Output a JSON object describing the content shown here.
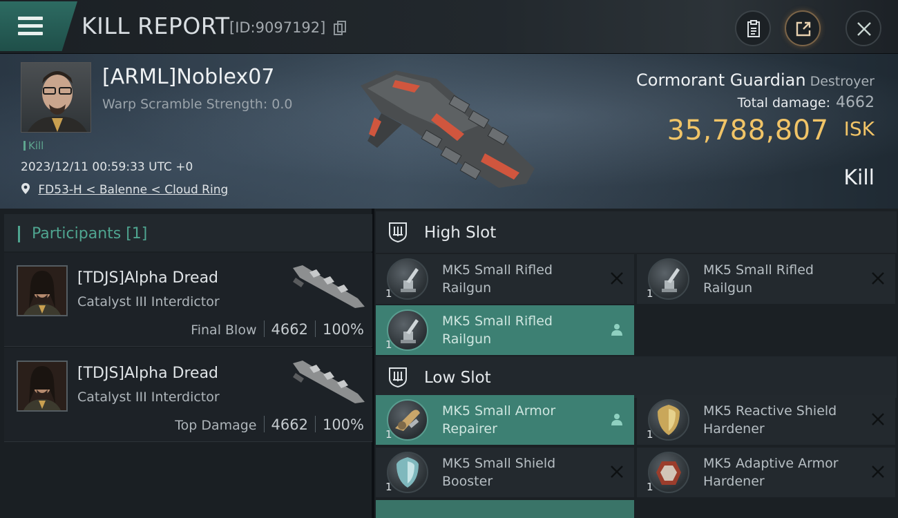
{
  "header": {
    "title": "KILL REPORT",
    "report_id": "[ID:9097192]"
  },
  "victim": {
    "pilot_name": "[ARML]Noblex07",
    "warp_scramble": "Warp Scramble Strength: 0.0",
    "kill_tag": "Kill",
    "timestamp": "2023/12/11 00:59:33 UTC +0",
    "location": "FD53-H < Balenne < Cloud Ring",
    "ship_name": "Cormorant Guardian",
    "ship_class": "Destroyer",
    "total_damage_label": "Total damage:",
    "total_damage": "4662",
    "isk_value": "35,788,807",
    "isk_unit": "ISK",
    "result": "Kill"
  },
  "participants": {
    "title": "Participants [1]",
    "rows": [
      {
        "name": "[TDJS]Alpha Dread",
        "ship": "Catalyst III Interdictor",
        "role": "Final Blow",
        "damage": "4662",
        "percent": "100%"
      },
      {
        "name": "[TDJS]Alpha Dread",
        "ship": "Catalyst III Interdictor",
        "role": "Top Damage",
        "damage": "4662",
        "percent": "100%"
      }
    ]
  },
  "fitting": {
    "high_slot_label": "High Slot",
    "low_slot_label": "Low Slot",
    "high": [
      {
        "name": "MK5 Small Rifled Railgun",
        "qty": "1",
        "state": "destroyed"
      },
      {
        "name": "MK5 Small Rifled Railgun",
        "qty": "1",
        "state": "destroyed"
      },
      {
        "name": "MK5 Small Rifled Railgun",
        "qty": "1",
        "state": "dropped"
      }
    ],
    "low": [
      {
        "name": "MK5 Small Armor Repairer",
        "qty": "1",
        "state": "dropped"
      },
      {
        "name": "MK5 Reactive Shield Hardener",
        "qty": "1",
        "state": "destroyed"
      },
      {
        "name": "MK5 Small Shield Booster",
        "qty": "1",
        "state": "destroyed"
      },
      {
        "name": "MK5 Adaptive Armor Hardener",
        "qty": "1",
        "state": "destroyed"
      }
    ]
  },
  "colors": {
    "accent": "#3d8073",
    "isk": "#f1c467",
    "participants_header": "#4fa590"
  },
  "icons": {
    "menu": "hamburger-icon",
    "copy": "copy-icon",
    "clipboard": "clipboard-icon",
    "share": "share-icon",
    "close": "close-icon",
    "location": "location-pin-icon",
    "slot": "slot-icon",
    "destroyed": "x-icon",
    "dropped": "person-icon"
  }
}
